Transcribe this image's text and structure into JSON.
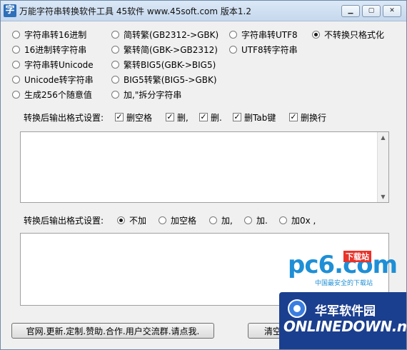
{
  "window": {
    "app_icon_char": "字",
    "title": "万能字符串转换软件工具 45软件 www.45soft.com 版本1.2"
  },
  "modes": [
    {
      "label": "字符串转16进制",
      "selected": false
    },
    {
      "label": "16进制转字符串",
      "selected": false
    },
    {
      "label": "字符串转Unicode",
      "selected": false
    },
    {
      "label": "Unicode转字符串",
      "selected": false
    },
    {
      "label": "生成256个随意值",
      "selected": false
    },
    {
      "label": "简转繁(GB2312->GBK)",
      "selected": false
    },
    {
      "label": "繁转简(GBK->GB2312)",
      "selected": false
    },
    {
      "label": "繁转BIG5(GBK->BIG5)",
      "selected": false
    },
    {
      "label": "BIG5转繁(BIG5->GBK)",
      "selected": false
    },
    {
      "label": "加,\"拆分字符串",
      "selected": false
    },
    {
      "label": "字符串转UTF8",
      "selected": false
    },
    {
      "label": "UTF8转字符串",
      "selected": false
    },
    {
      "label": "不转换只格式化",
      "selected": true
    }
  ],
  "format1": {
    "label": "转换后输出格式设置:",
    "options": [
      {
        "label": "删空格",
        "checked": true
      },
      {
        "label": "删,",
        "checked": true
      },
      {
        "label": "删.",
        "checked": true
      },
      {
        "label": "删Tab键",
        "checked": true
      },
      {
        "label": "删换行",
        "checked": true
      }
    ]
  },
  "format2": {
    "label": "转换后输出格式设置:",
    "options": [
      {
        "label": "不加",
        "selected": true
      },
      {
        "label": "加空格",
        "selected": false
      },
      {
        "label": "加,",
        "selected": false
      },
      {
        "label": "加.",
        "selected": false
      },
      {
        "label": "加0x ,",
        "selected": false
      }
    ]
  },
  "input_text": "",
  "output_text": "",
  "buttons": {
    "website": "官网.更新.定制.赞助.合作.用户交流群.请点我.",
    "clear": "清空"
  },
  "watermarks": {
    "pc6_logo": "pc6.com",
    "pc6_tag": "下载站",
    "pc6_sub": "中国最安全的下载站",
    "od_cn": "华军软件园",
    "od_en": "ONLINEDOWN.net"
  }
}
